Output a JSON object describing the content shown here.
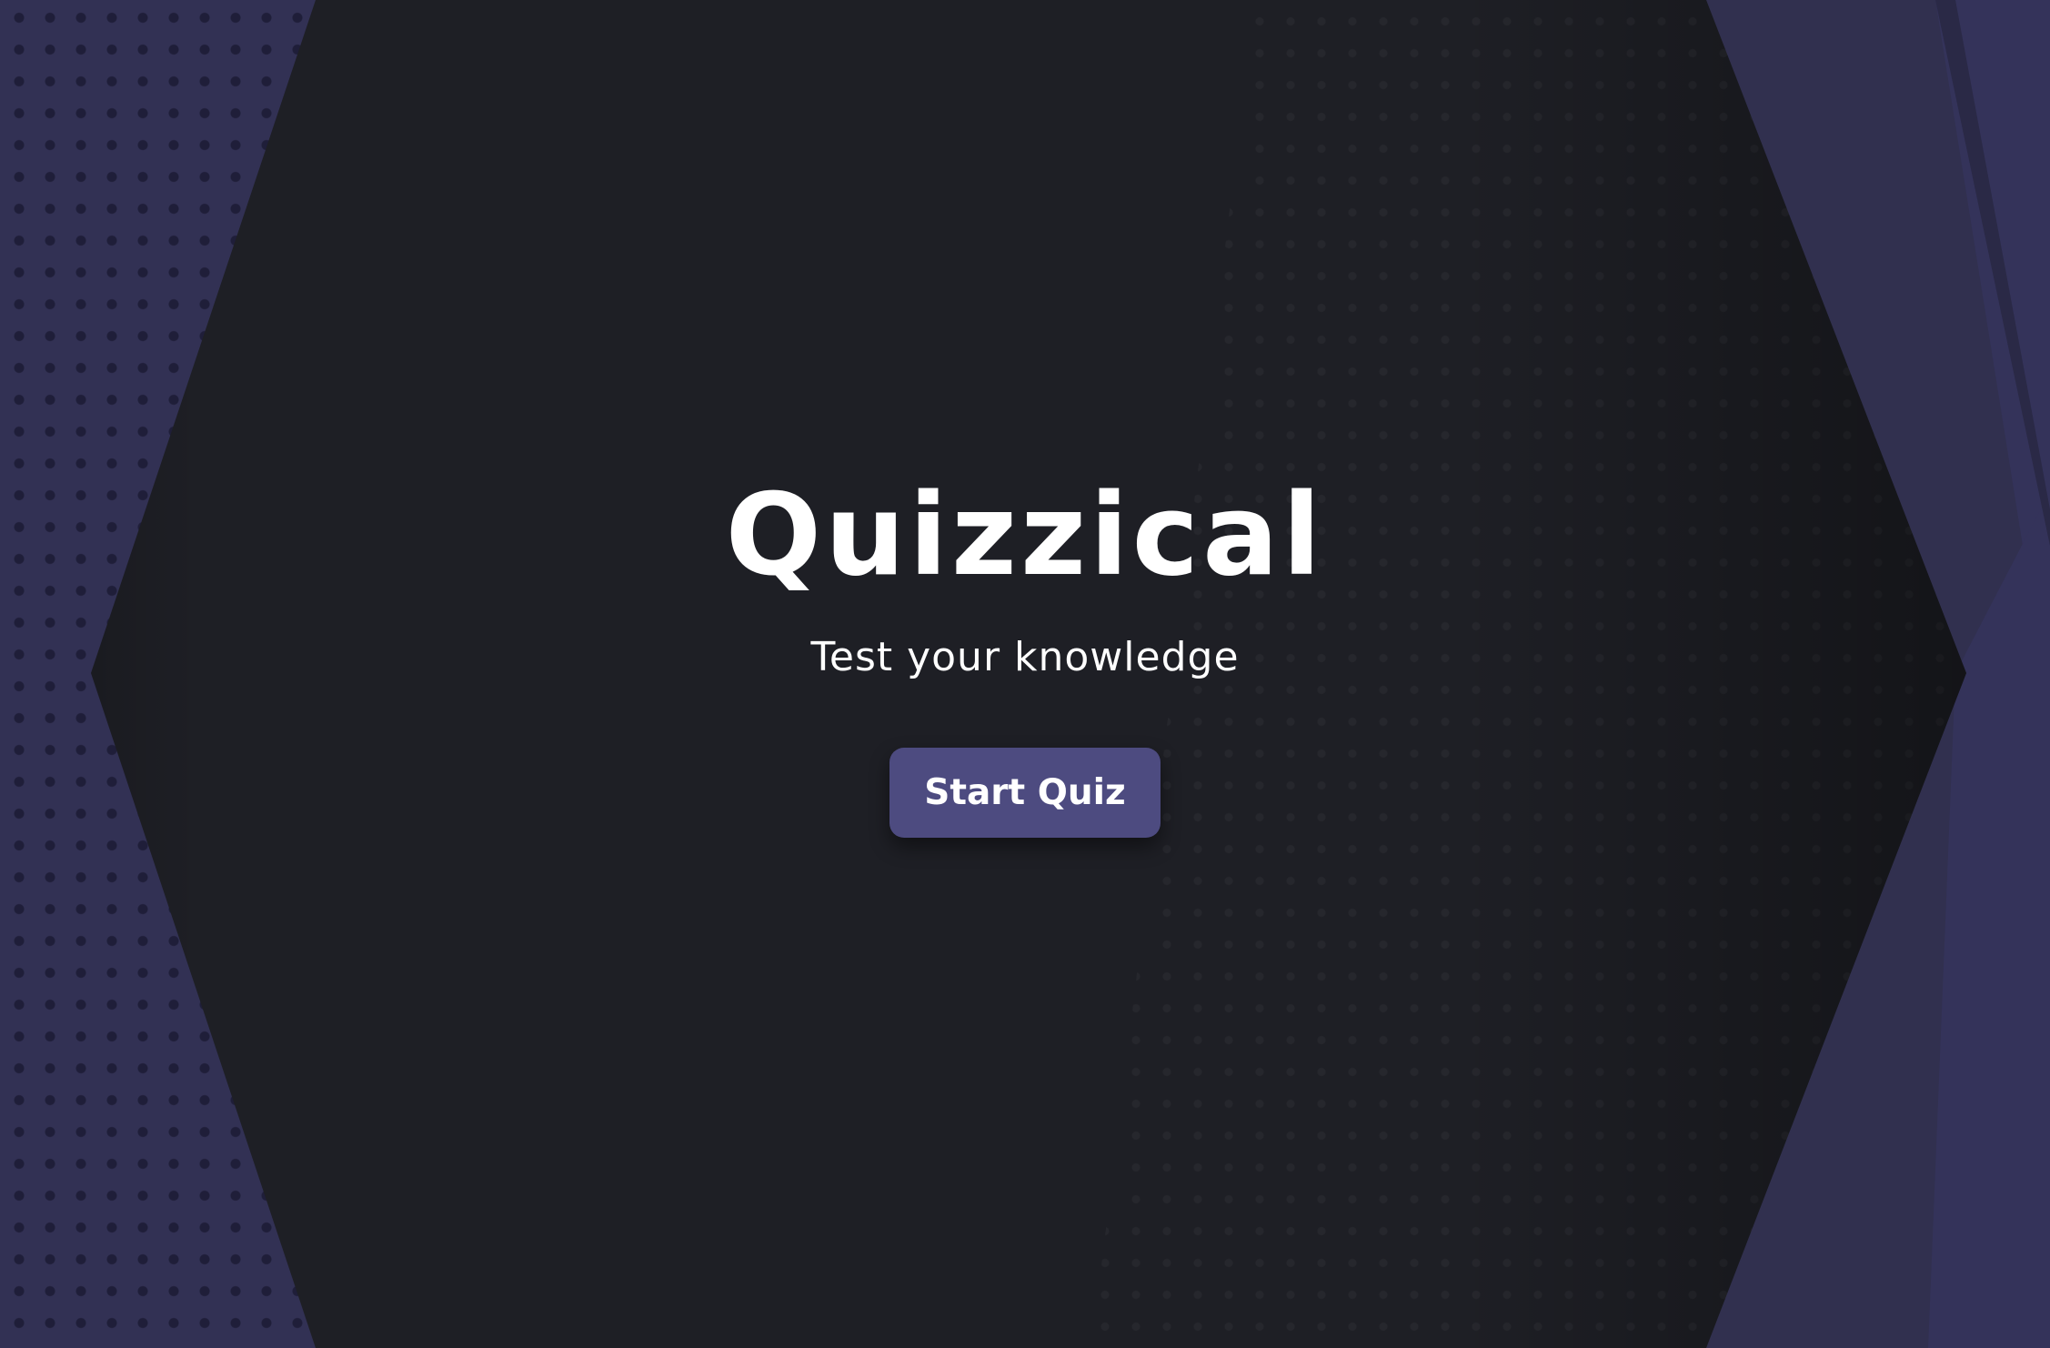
{
  "app": {
    "title": "Quizzical",
    "subtitle": "Test your knowledge"
  },
  "actions": {
    "start_label": "Start Quiz"
  },
  "colors": {
    "background_accent": "#323154",
    "panel": "#1e1f25",
    "button": "#4d4b80",
    "text": "#ffffff"
  }
}
